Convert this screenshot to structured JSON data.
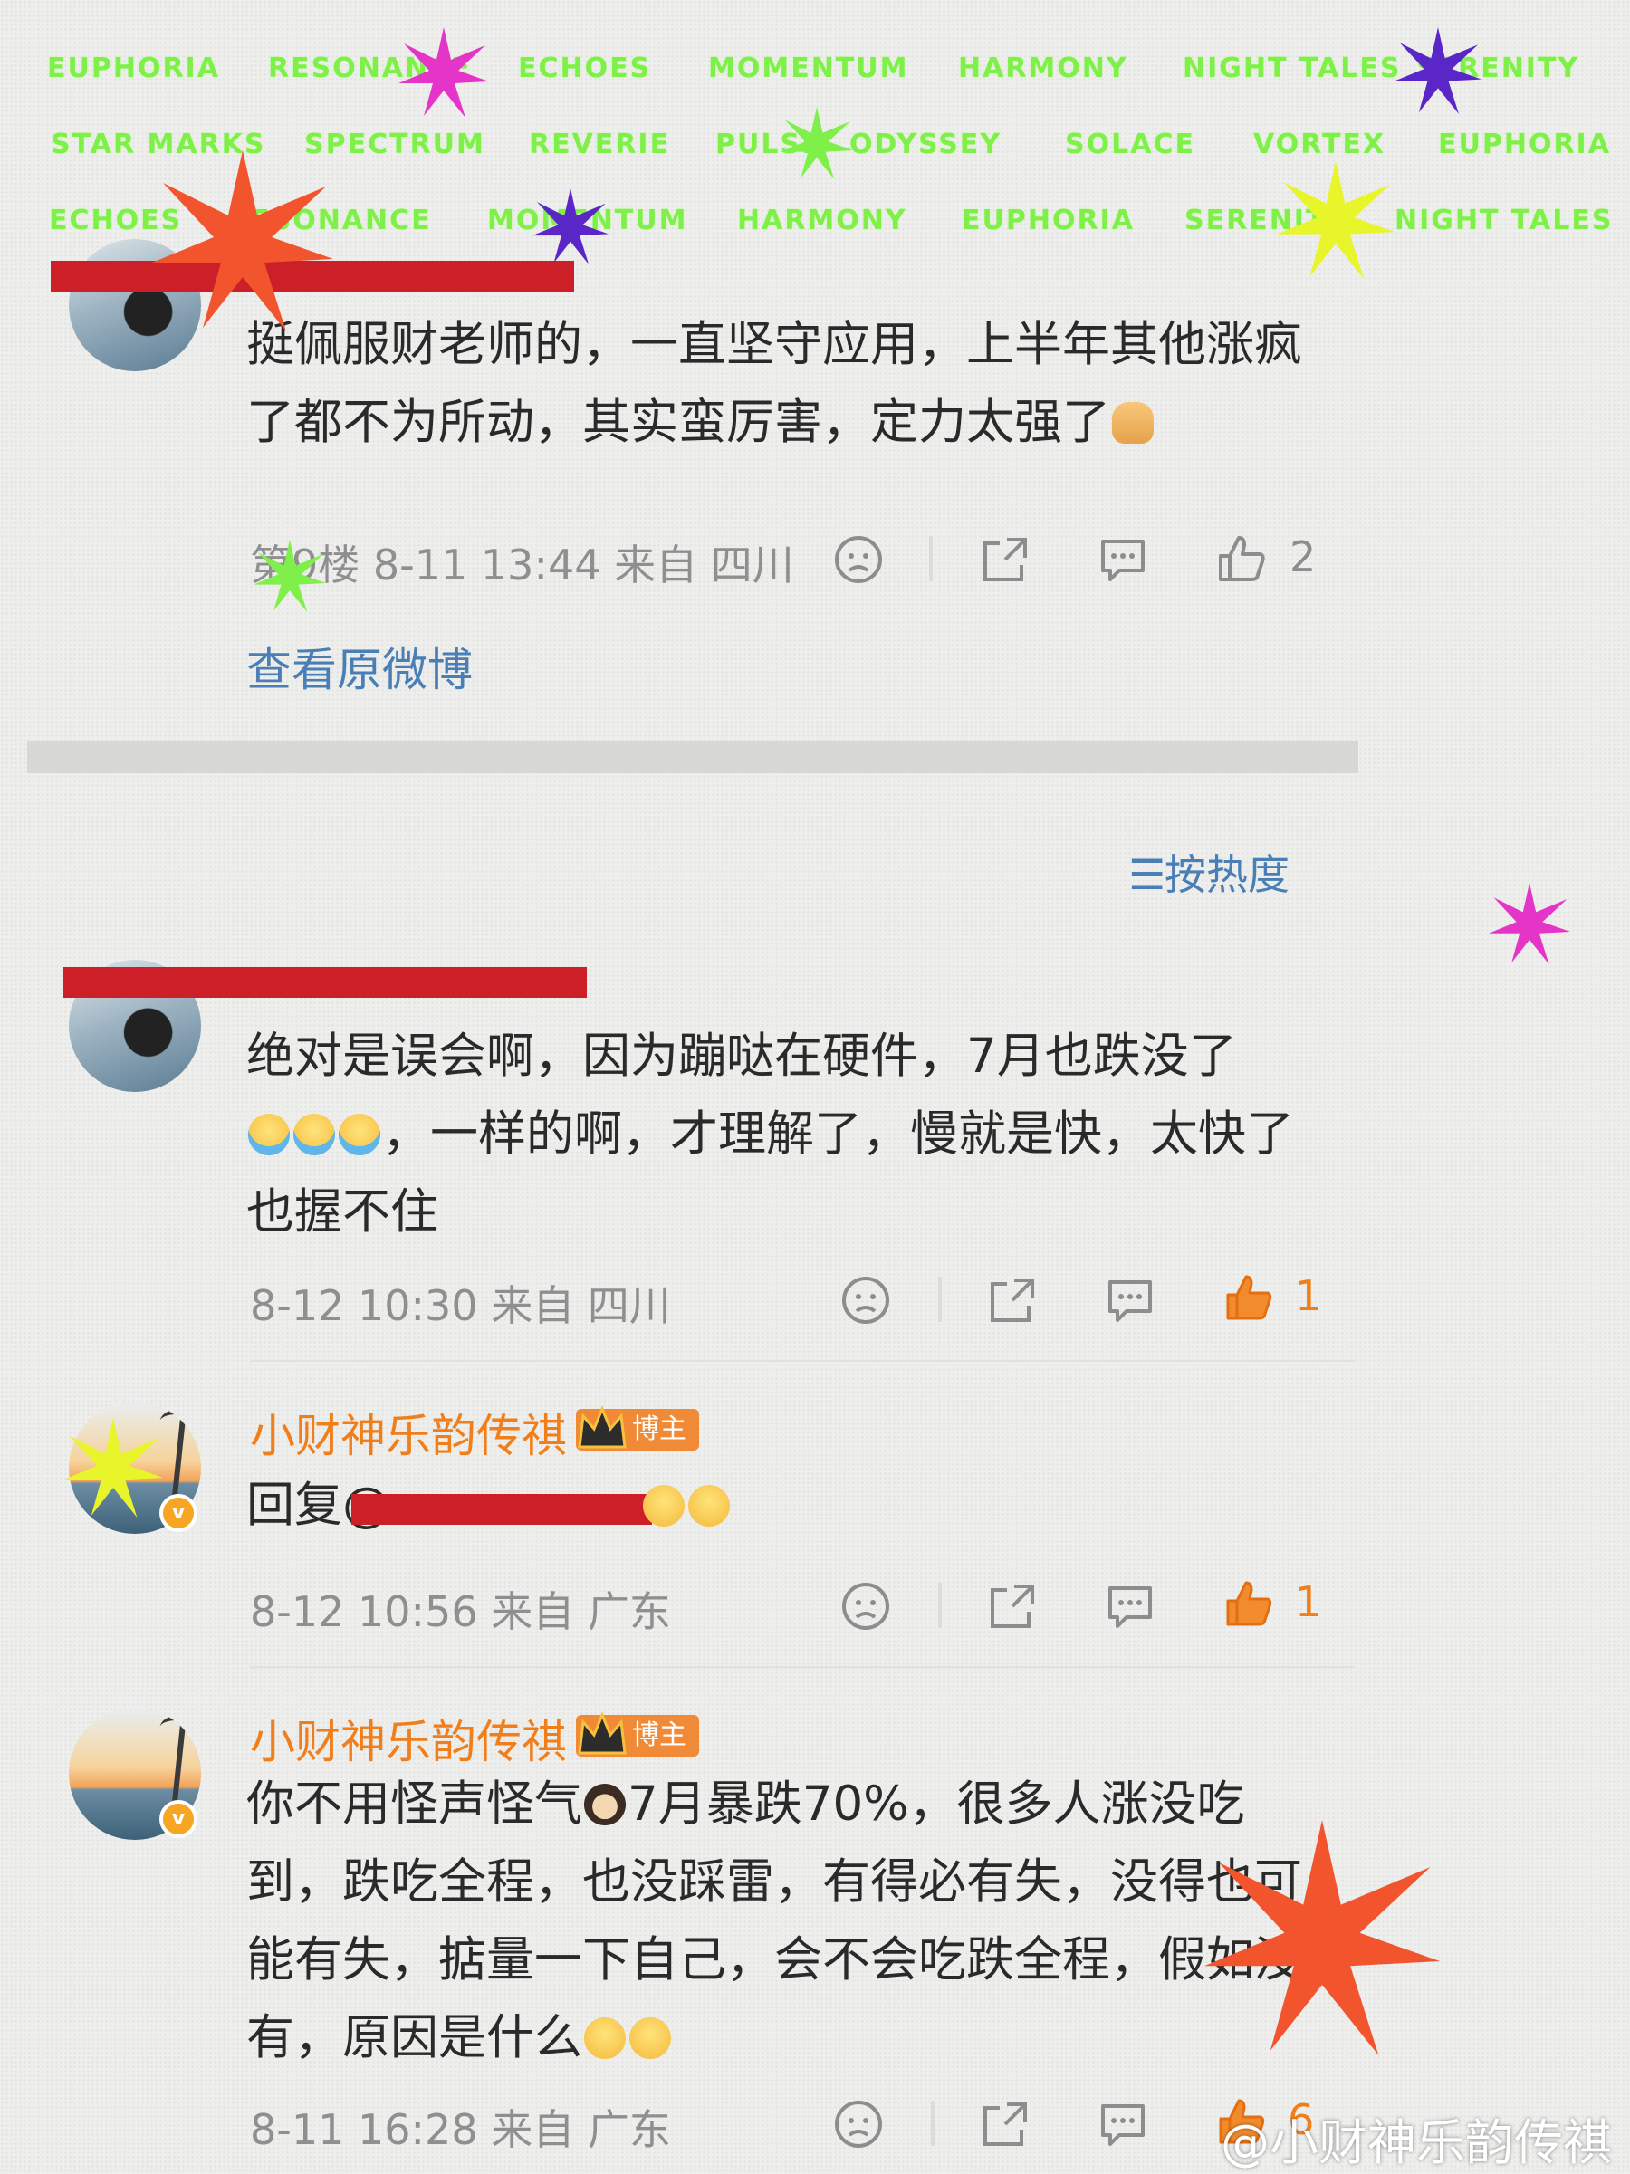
{
  "stickers": {
    "row1": [
      "EUPHORIA",
      "RESONANCE",
      "ECHOES",
      "MOMENTUM",
      "HARMONY",
      "NIGHT TALES",
      "SERENITY"
    ],
    "row2": [
      "STAR MARKS",
      "SPECTRUM",
      "REVERIE",
      "PULSE",
      "ODYSSEY",
      "SOLACE",
      "VORTEX",
      "EUPHORIA"
    ],
    "row3": [
      "ECHOES",
      "RESONANCE",
      "MOMENTUM",
      "HARMONY",
      "EUPHORIA",
      "SERENITY",
      "NIGHT TALES"
    ],
    "color": "#7ff04a"
  },
  "comment1": {
    "text": "挺佩服财老师的，一直坚守应用，上半年其他涨疯了都不为所动，其实蛮厉害，定力太强了",
    "meta": "第9楼 8-11 13:44 来自 四川",
    "likes": "2",
    "view_original": "查看原微博"
  },
  "sort_label": "按热度",
  "comment2": {
    "text_a": "绝对是误会啊，因为蹦哒在硬件，7月也跌没了",
    "text_b": "，一样的啊，才理解了，慢就是快，太快了也握不住",
    "meta": "8-12 10:30 来自 四川",
    "likes": "1"
  },
  "reply1": {
    "name": "小财神乐韵传祺",
    "badge": "博主",
    "text": "回复@",
    "meta": "8-12 10:56 来自 广东",
    "likes": "1"
  },
  "reply2": {
    "name": "小财神乐韵传祺",
    "badge": "博主",
    "text_a": "你不用怪声怪气",
    "text_b": "7月暴跌70%，很多人涨没吃到，跌吃全程，也没踩雷，有得必有失，没得也可能有失，掂量一下自己，会不会吃跌全程，假如没有，原因是什么",
    "meta": "8-11 16:28 来自 广东",
    "likes": "6"
  },
  "watermark": "@小财神乐韵传祺",
  "colors": {
    "accent_orange": "#f07f1b",
    "link_blue": "#4a7fb5",
    "redaction": "#cc1f27"
  }
}
